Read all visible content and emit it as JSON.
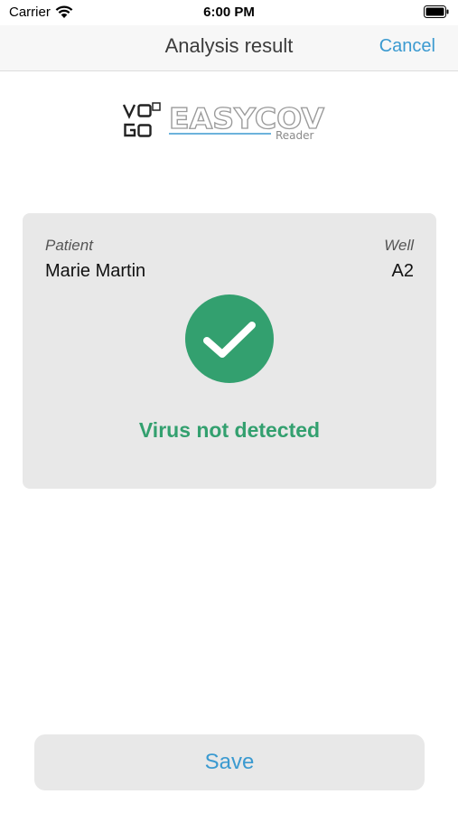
{
  "status_bar": {
    "carrier": "Carrier",
    "time": "6:00 PM",
    "icons": [
      "wifi-icon",
      "battery-icon"
    ]
  },
  "nav": {
    "title": "Analysis result",
    "cancel_label": "Cancel"
  },
  "logo": {
    "brand": "VOGO",
    "product": "EASYCOV",
    "subtitle": "Reader"
  },
  "result": {
    "patient_caption": "Patient",
    "patient_name": "Marie Martin",
    "well_caption": "Well",
    "well_value": "A2",
    "icon": "checkmark-icon",
    "status_text": "Virus not detected",
    "status_color": "#33a06f"
  },
  "actions": {
    "save_label": "Save"
  },
  "colors": {
    "accent": "#3b9ad0",
    "card_background": "#e8e8e8"
  }
}
